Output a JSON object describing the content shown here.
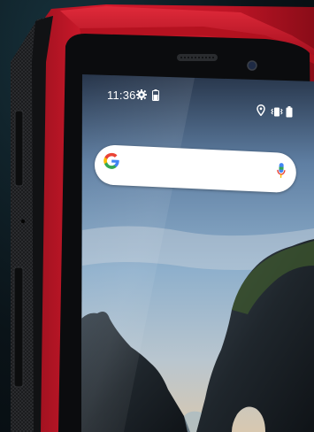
{
  "status_bar": {
    "time": "11:36",
    "left_icons": [
      "gear-icon",
      "battery-icon"
    ],
    "right_icons": [
      "location-icon",
      "vibrate-icon",
      "battery-icon"
    ]
  },
  "search_widget": {
    "logo": "google-g-logo",
    "action_icon": "mic-icon"
  },
  "colors": {
    "body_red": "#c8192a",
    "rubber_black": "#1a1a1c",
    "screen_sky": "#7aa0bf",
    "background": "#0a1318"
  }
}
